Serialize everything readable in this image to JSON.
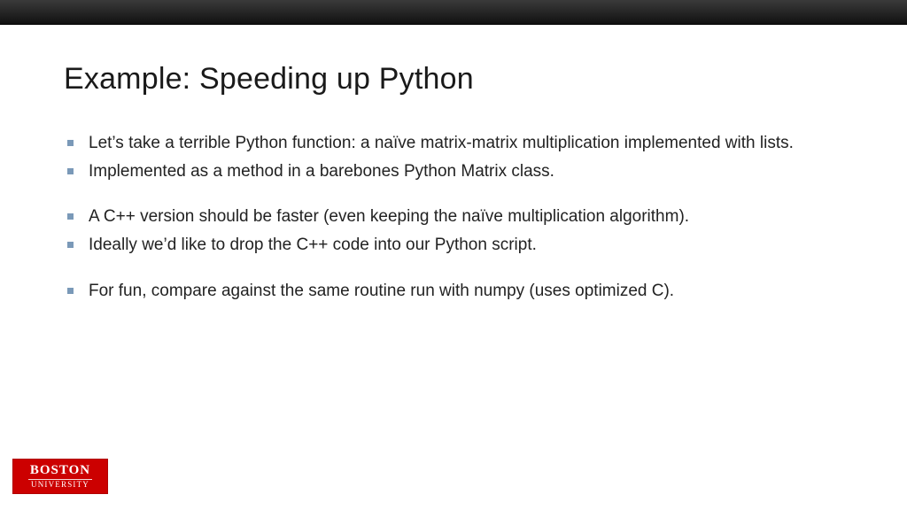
{
  "title": "Example: Speeding up Python",
  "bullets": {
    "g1": [
      "Let’s take a terrible Python function: a naïve matrix-matrix multiplication implemented with lists.",
      "Implemented as a method in a barebones Python Matrix class."
    ],
    "g2": [
      "A C++ version should be faster (even keeping the naïve multiplication algorithm).",
      "Ideally we’d like to drop the C++ code into our Python script."
    ],
    "g3": [
      "For fun, compare against the same routine run with numpy (uses optimized C)."
    ]
  },
  "logo": {
    "line1": "BOSTON",
    "line2": "UNIVERSITY"
  }
}
